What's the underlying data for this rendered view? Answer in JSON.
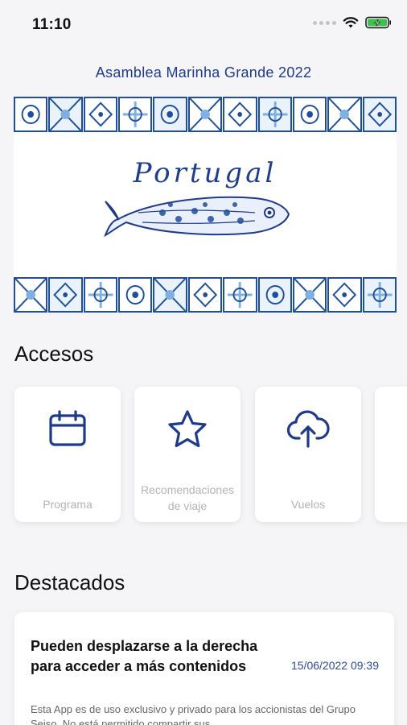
{
  "status": {
    "time": "11:10"
  },
  "header": {
    "event_title": "Asamblea Marinha Grande 2022"
  },
  "banner": {
    "script_text": "Portugal"
  },
  "accesos": {
    "heading": "Accesos",
    "items": [
      {
        "label": "Programa",
        "icon": "calendar-icon"
      },
      {
        "label": "Recomendaciones de viaje",
        "icon": "star-icon"
      },
      {
        "label": "Vuelos",
        "icon": "cloud-upload-icon"
      }
    ]
  },
  "destacados": {
    "heading": "Destacados",
    "items": [
      {
        "title": "Pueden desplazarse a la derecha para acceder a más contenidos",
        "date": "15/06/2022 09:39",
        "body": "Esta App es de uso exclusivo y privado para los accionistas del Grupo Seiso. No está permitido compartir sus"
      }
    ]
  },
  "colors": {
    "accent": "#1e3a8a",
    "tile_blue": "#1e4e9e",
    "tile_light": "#7fb0e0"
  }
}
